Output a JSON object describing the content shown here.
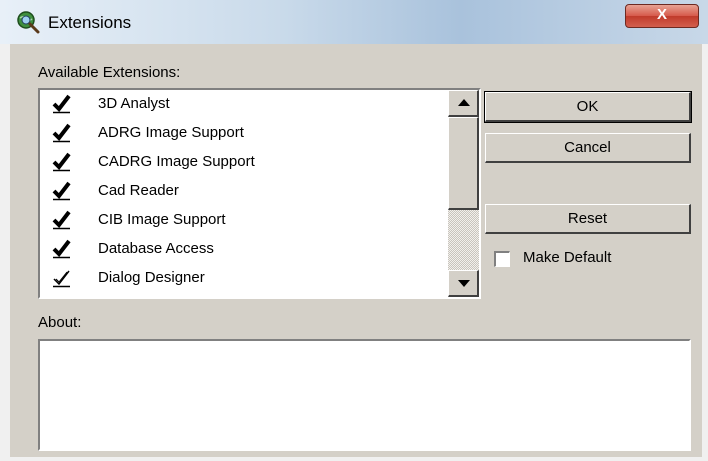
{
  "window": {
    "title": "Extensions",
    "close_label": "X",
    "icon": "globe-magnifier-icon"
  },
  "list": {
    "label": "Available Extensions:",
    "items": [
      {
        "label": "3D Analyst",
        "checked": true,
        "icon": "bold-check-icon"
      },
      {
        "label": "ADRG Image Support",
        "checked": true,
        "icon": "bold-check-icon"
      },
      {
        "label": "CADRG Image Support",
        "checked": true,
        "icon": "bold-check-icon"
      },
      {
        "label": "Cad Reader",
        "checked": true,
        "icon": "bold-check-icon"
      },
      {
        "label": "CIB Image Support",
        "checked": true,
        "icon": "bold-check-icon"
      },
      {
        "label": "Database Access",
        "checked": true,
        "icon": "bold-check-icon"
      },
      {
        "label": "Dialog Designer",
        "checked": true,
        "icon": "outline-check-icon"
      }
    ]
  },
  "buttons": {
    "ok": "OK",
    "cancel": "Cancel",
    "reset": "Reset"
  },
  "make_default": {
    "label": "Make Default",
    "checked": false
  },
  "about": {
    "label": "About:",
    "text": ""
  }
}
